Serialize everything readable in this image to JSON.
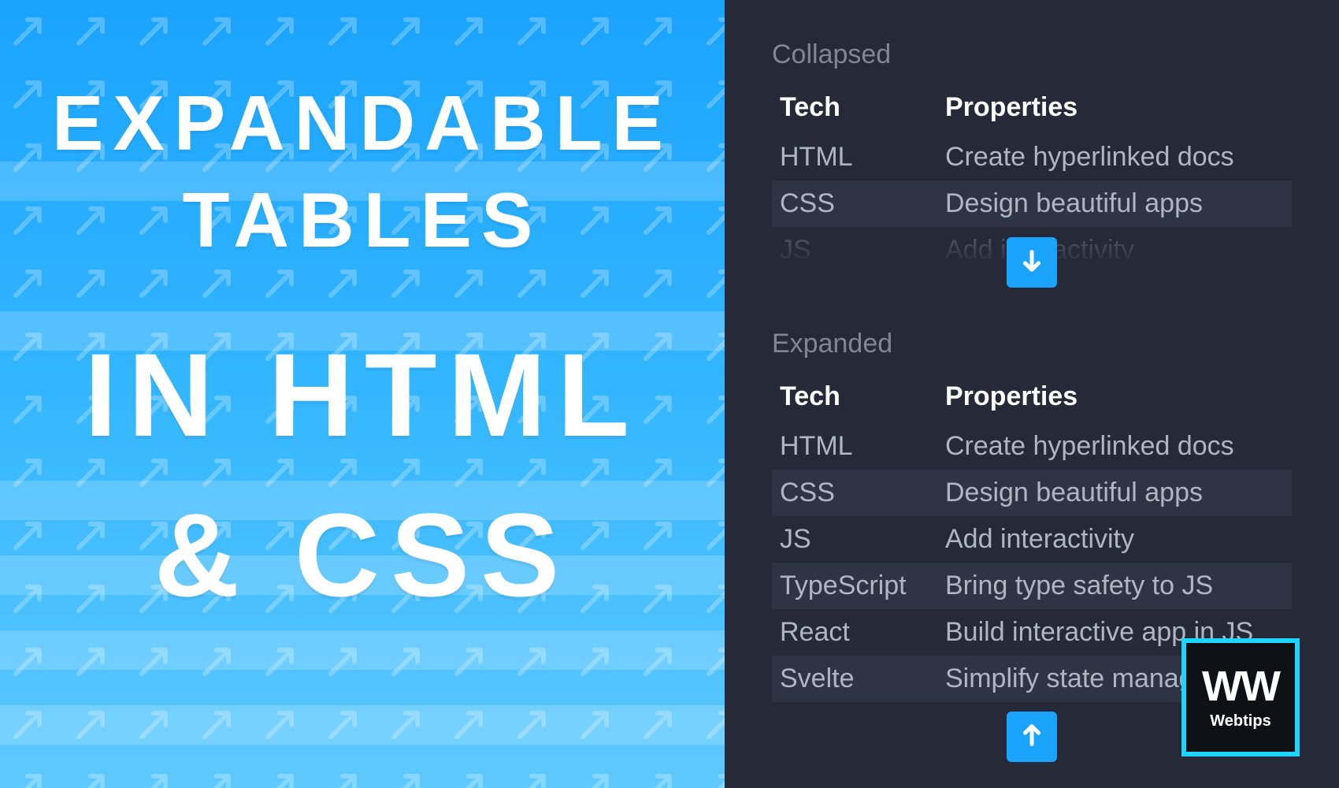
{
  "headline": {
    "line1": "EXPANDABLE",
    "line2": "TABLES",
    "line3": "IN HTML",
    "line4": "& CSS"
  },
  "sections": {
    "collapsed_label": "Collapsed",
    "expanded_label": "Expanded"
  },
  "table": {
    "headers": {
      "tech": "Tech",
      "props": "Properties"
    },
    "rows": [
      {
        "tech": "HTML",
        "props": "Create hyperlinked docs"
      },
      {
        "tech": "CSS",
        "props": "Design beautiful apps"
      },
      {
        "tech": "JS",
        "props": "Add interactivity"
      },
      {
        "tech": "TypeScript",
        "props": "Bring type safety to JS"
      },
      {
        "tech": "React",
        "props": "Build interactive app in JS"
      },
      {
        "tech": "Svelte",
        "props": "Simplify state management"
      }
    ]
  },
  "logo": {
    "mark": "WW",
    "name": "Webtips"
  }
}
